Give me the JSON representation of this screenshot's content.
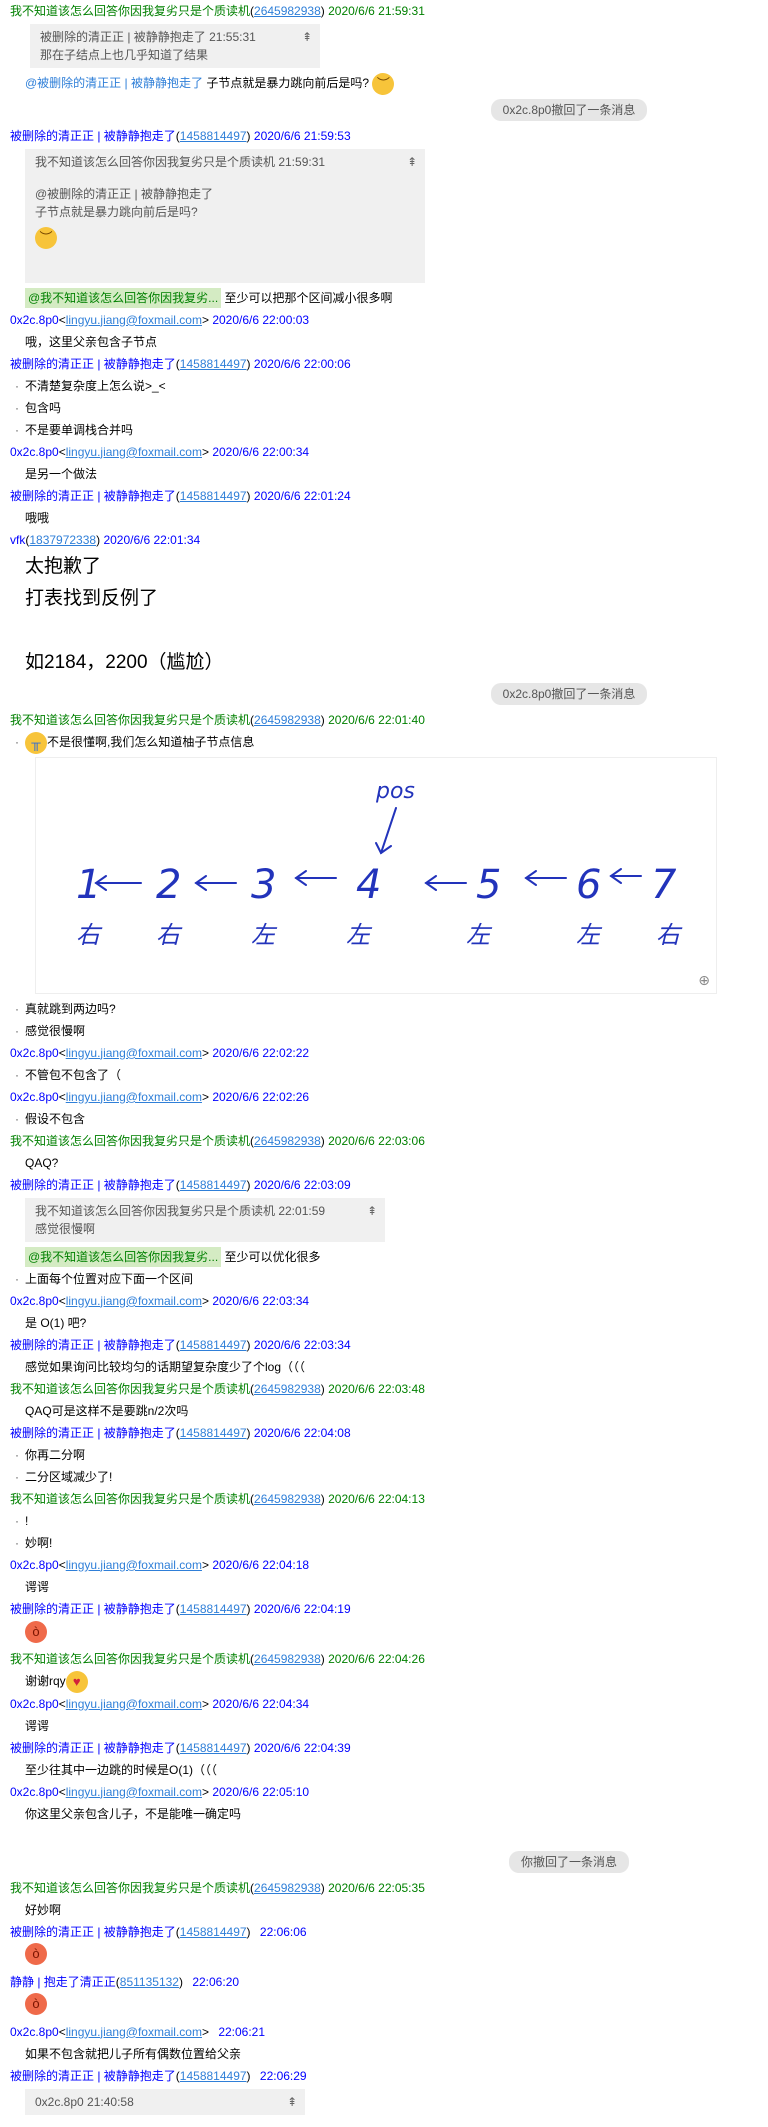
{
  "names": {
    "green": "我不知道该怎么回答你因我复劣只是个质读机",
    "green_qq": "2645982938",
    "blue": "被删除的清正正 | 被静静抱走了",
    "blue_qq": "1458814497",
    "ox": "0x2c.8p0",
    "ox_mail": "lingyu.jiang@foxmail.com",
    "vfk": "vfk",
    "vfk_qq": "1837972338",
    "jj": "静静 | 抱走了清正正",
    "jj_qq": "851135132"
  },
  "sys": {
    "recall_ox": "0x2c.8p0撤回了一条消息",
    "recall_you": "你撤回了一条消息"
  },
  "msgs": {
    "t0": "2020/6/6 21:59:31",
    "q0_head": "被删除的清正正 | 被静静抱走了  21:55:31",
    "q0_text": "那在子结点上也几乎知道了结果",
    "m0_at": "@被删除的清正正 | 被静静抱走了",
    "m0_text": "子节点就是暴力跳向前后是吗?",
    "t1": "2020/6/6 21:59:53",
    "q1_head": "我不知道该怎么回答你因我复劣只是个质读机  21:59:31",
    "q1_l1": "@被删除的清正正 | 被静静抱走了",
    "q1_l2": "子节点就是暴力跳向前后是吗?",
    "m1_at": "@我不知道该怎么回答你因我复劣...",
    "m1_text": "至少可以把那个区间减小很多啊",
    "t2": "2020/6/6 22:00:03",
    "m2": "哦，这里父亲包含子节点",
    "t3": "2020/6/6 22:00:06",
    "m3a": "不清楚复杂度上怎么说>_<",
    "m3b": "包含吗",
    "m3c": "不是要单调栈合并吗",
    "t4": "2020/6/6 22:00:34",
    "m4": "是另一个做法",
    "t5": "2020/6/6 22:01:24",
    "m5": "哦哦",
    "t6": "2020/6/6 22:01:34",
    "m6a": "太抱歉了",
    "m6b": "打表找到反例了",
    "m6c": "如2184，2200（尴尬）",
    "t7": "2020/6/6 22:01:40",
    "m7": "不是很懂啊,我们怎么知道柚子节点信息",
    "m7b": "真就跳到两边吗?",
    "m7c": "感觉很慢啊",
    "t8": "2020/6/6 22:02:22",
    "m8": "不管包不包含了（",
    "t9": "2020/6/6 22:02:26",
    "m9": "假设不包含",
    "t10": "2020/6/6 22:03:06",
    "m10": "QAQ?",
    "t11": "2020/6/6 22:03:09",
    "q11_head": "我不知道该怎么回答你因我复劣只是个质读机  22:01:59",
    "q11_text": "感觉很慢啊",
    "m11_at": "@我不知道该怎么回答你因我复劣...",
    "m11_text": "至少可以优化很多",
    "m11b": "上面每个位置对应下面一个区间",
    "t12": "2020/6/6 22:03:34",
    "m12": "是 O(1) 吧?",
    "t13": "2020/6/6 22:03:34",
    "m13": "感觉如果询问比较均匀的话期望复杂度少了个log（（（",
    "t14": "2020/6/6 22:03:48",
    "m14": "QAQ可是这样不是要跳n/2次吗",
    "t15": "2020/6/6 22:04:08",
    "m15a": "你再二分啊",
    "m15b": "二分区域减少了!",
    "t16": "2020/6/6 22:04:13",
    "m16a": "!",
    "m16b": "妙啊!",
    "t17": "2020/6/6 22:04:18",
    "m17": "谔谔",
    "t18": "2020/6/6 22:04:19",
    "t19": "2020/6/6 22:04:26",
    "m19": "谢谢rqy",
    "t20": "2020/6/6 22:04:34",
    "m20": "谔谔",
    "t21": "2020/6/6 22:04:39",
    "m21": "至少往其中一边跳的时候是O(1)（（（",
    "t22": "2020/6/6 22:05:10",
    "m22": "你这里父亲包含儿子，不是能唯一确定吗",
    "t23": "2020/6/6 22:05:35",
    "m23": "好妙啊",
    "t24": "22:06:06",
    "t25": "22:06:20",
    "t26": "22:06:21",
    "m26": "如果不包含就把儿子所有偶数位置给父亲",
    "t27": "22:06:29",
    "q27_head": "0x2c.8p0   21:40:58"
  },
  "drawing": {
    "pos_label": "pos",
    "numbers": [
      "1",
      "2",
      "3",
      "4",
      "5",
      "6",
      "7"
    ],
    "dirs": [
      "右",
      "右",
      "左",
      "左",
      "左",
      "左",
      "右"
    ]
  },
  "icons": {
    "pin": "pin-icon",
    "zoom": "zoom-in-icon"
  }
}
